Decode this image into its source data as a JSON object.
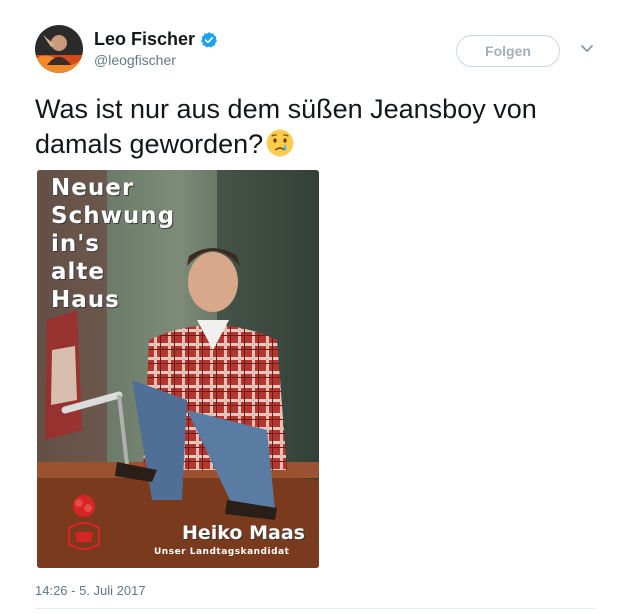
{
  "tweet": {
    "author_name": "Leo Fischer",
    "author_handle": "@leogfischer",
    "follow_label": "Folgen",
    "text": "Was ist nur aus dem süßen Jeansboy von damals geworden?",
    "emoji": "crying-face",
    "timestamp": "14:26 - 5. Juli 2017"
  },
  "poster": {
    "slogan": [
      "Neuer",
      "Schwung",
      "in's",
      "alte",
      "Haus"
    ],
    "candidate_name": "Heiko Maas",
    "candidate_subtitle": "Unser Landtagskandidat"
  },
  "colors": {
    "verified_blue": "#1da1f2",
    "text_primary": "#14171a",
    "text_secondary": "#657786",
    "border": "#ccd6dd"
  }
}
